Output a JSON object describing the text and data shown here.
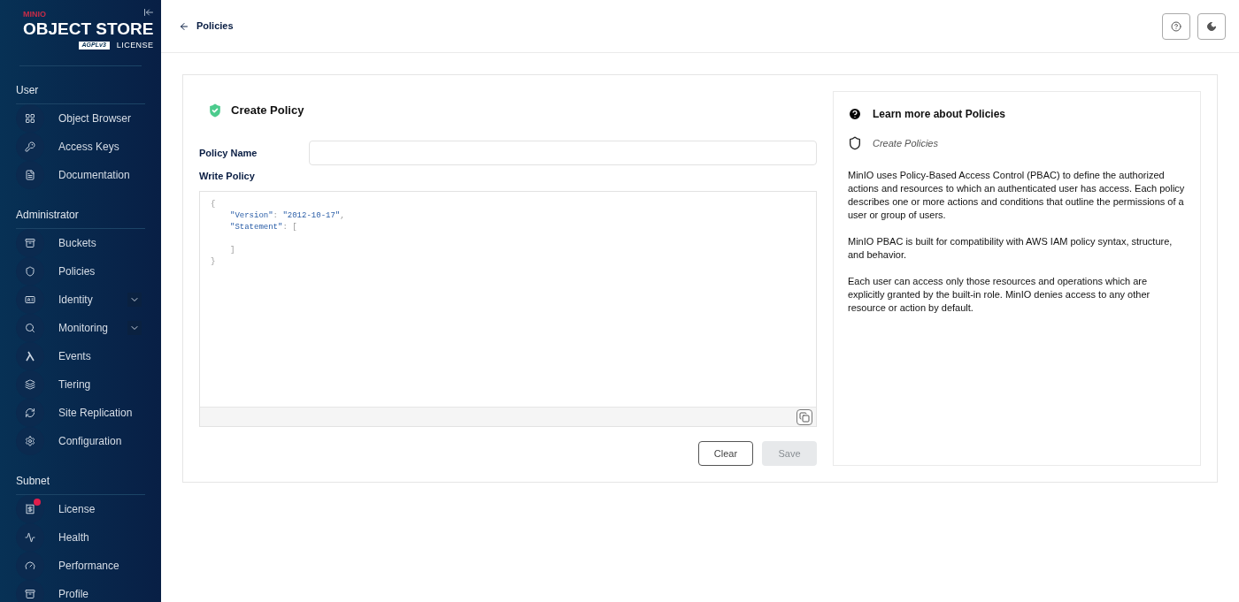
{
  "logo": {
    "brand": "MINIO",
    "product": "OBJECT STORE",
    "badge": "AGPLv3",
    "license": "LICENSE"
  },
  "sidebar": {
    "sections": [
      {
        "title": "User",
        "items": [
          {
            "label": "Object Browser",
            "kind": "plain"
          },
          {
            "label": "Access Keys",
            "kind": "plain"
          },
          {
            "label": "Documentation",
            "kind": "plain"
          }
        ]
      },
      {
        "title": "Administrator",
        "items": [
          {
            "label": "Buckets",
            "kind": "plain"
          },
          {
            "label": "Policies",
            "kind": "plain"
          },
          {
            "label": "Identity",
            "kind": "expandable",
            "expanded": false
          },
          {
            "label": "Monitoring",
            "kind": "expandable",
            "expanded": false
          },
          {
            "label": "Events",
            "kind": "plain"
          },
          {
            "label": "Tiering",
            "kind": "plain"
          },
          {
            "label": "Site Replication",
            "kind": "plain"
          },
          {
            "label": "Configuration",
            "kind": "plain"
          }
        ]
      },
      {
        "title": "Subnet",
        "items": [
          {
            "label": "License",
            "kind": "notified"
          },
          {
            "label": "Health",
            "kind": "plain"
          },
          {
            "label": "Performance",
            "kind": "plain"
          },
          {
            "label": "Profile",
            "kind": "plain"
          }
        ]
      }
    ]
  },
  "header": {
    "back_link": "Policies"
  },
  "form": {
    "title": "Create Policy",
    "name_label": "Policy Name",
    "write_label": "Write Policy",
    "code_lines": [
      {
        "kind": "open",
        "text": "{"
      },
      {
        "kind": "pair",
        "key": "\"Version\"",
        "sep": ":",
        "value": "\"2012-10-17\"",
        "trail": ","
      },
      {
        "kind": "pair_open",
        "key": "\"Statement\"",
        "sep": ":",
        "trail": "["
      },
      {
        "kind": "blank"
      },
      {
        "kind": "inner_close",
        "text": "]"
      },
      {
        "kind": "close",
        "text": "}"
      }
    ],
    "buttons": [
      {
        "label": "Clear",
        "disabled": false
      },
      {
        "label": "Save",
        "disabled": true
      }
    ]
  },
  "help": {
    "title": "Learn more about Policies",
    "subtitle": "Create Policies",
    "paragraphs": [
      "MinIO uses Policy-Based Access Control (PBAC) to define the authorized actions and resources to which an authenticated user has access. Each policy describes one or more actions and conditions that outline the permissions of a user or group of users.",
      "MinIO PBAC is built for compatibility with AWS IAM policy syntax, structure, and behavior.",
      "Each user can access only those resources and operations which are explicitly granted by the built-in role. MinIO denies access to any other resource or action by default."
    ]
  }
}
